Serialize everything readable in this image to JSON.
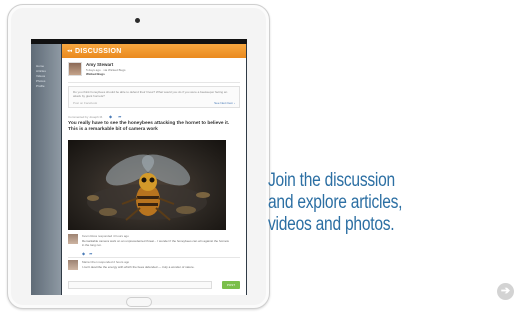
{
  "app": {
    "header_title": "DISCUSSION",
    "back_glyph": "◂◂",
    "user": {
      "name": "Amy Stewart",
      "meta": "5 days ago · via Wicked Bugs",
      "role": "Wicked Bugs"
    },
    "prompt": {
      "text": "Do you think honeybees should be able to defend their hives? What would you do if you were a beekeeper facing an attack by giant hornets?",
      "footer": "Post on Facebook",
      "link": "See Next Item ›"
    },
    "meta": {
      "label": "Commented by Joseph M.",
      "like_glyph": "◆",
      "reply_glyph": "➦"
    },
    "question": "You really have to see the honeybees attacking the hornet to believe it. This is a remarkable bit of camera work",
    "comments": [
      {
        "head": "Kevin Ross responded 4 hours ago",
        "body": "Remarkable camera work on an unprecedented threat... I wonder if the honeybees can win against the hornets in the long run."
      },
      {
        "head": "Maria Chen responded 2 hours ago",
        "body": "I can't describe the energy with which the bees defended — truly a wonder of nature."
      }
    ],
    "post_label": "POST"
  },
  "side_panel": {
    "text": "Home\nArticles\nVideos\nPhotos\nProfile"
  },
  "promo": {
    "line1": "Join the discussion",
    "line2": "and explore articles,",
    "line3": "videos and photos."
  },
  "next_button": {
    "glyph": "➔"
  },
  "colors": {
    "accent_orange": "#ea8a1f",
    "promo_blue": "#2c6fa3",
    "post_green": "#7bbf4a"
  },
  "icons": [
    "back-arrow-icon",
    "like-icon",
    "reply-icon",
    "next-arrow-icon"
  ]
}
